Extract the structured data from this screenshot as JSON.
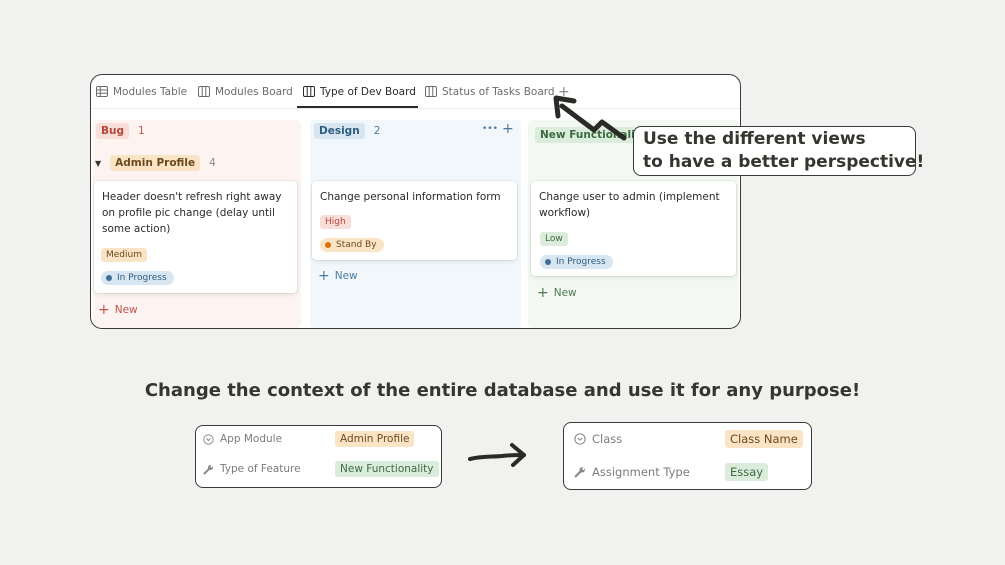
{
  "tabs": [
    {
      "label": "Modules Table",
      "icon": "table-icon"
    },
    {
      "label": "Modules Board",
      "icon": "board-icon"
    },
    {
      "label": "Type of Dev Board",
      "icon": "board-icon",
      "active": true
    },
    {
      "label": "Status of Tasks Board",
      "icon": "board-icon"
    }
  ],
  "add_view": "+",
  "columns": {
    "bug": {
      "label": "Bug",
      "count": "1",
      "color": "#f7ded9",
      "text_color": "#b6473a"
    },
    "design": {
      "label": "Design",
      "count": "2",
      "color": "#d8e6f1",
      "text_color": "#2f5d80",
      "more": "•••",
      "add": "+"
    },
    "newf": {
      "label": "New Functionality",
      "color": "#dcecdc",
      "text_color": "#3d6b40"
    }
  },
  "group": {
    "label": "Admin Profile",
    "count": "4",
    "color": "#fbe3c6",
    "toggle": "▼"
  },
  "cards": {
    "bug1": {
      "title": "Header doesn't refresh right away on profile pic change (delay until some action)",
      "priority": "Medium",
      "status": "In Progress"
    },
    "design1": {
      "title": "Change personal information form",
      "priority": "High",
      "status": "Stand By"
    },
    "newf1": {
      "title": "Change user to admin (implement workflow)",
      "priority": "Low",
      "status": "In Progress"
    }
  },
  "new_label": "New",
  "callout": {
    "line1": "Use the different views",
    "line2": "to have a better perspective!"
  },
  "headline": "Change the context of the entire database and use it for any purpose!",
  "left_props": [
    {
      "label": "App Module",
      "value": "Admin Profile",
      "icon": "target-icon"
    },
    {
      "label": "Type of Feature",
      "value": "New Functionality",
      "icon": "wrench-icon"
    }
  ],
  "right_props": [
    {
      "label": "Class",
      "value": "Class Name",
      "icon": "target-icon"
    },
    {
      "label": "Assignment Type",
      "value": "Essay",
      "icon": "wrench-icon"
    }
  ]
}
